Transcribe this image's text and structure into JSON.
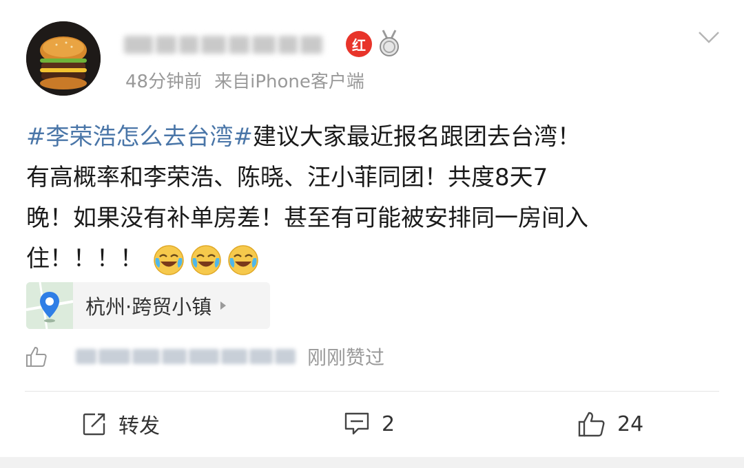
{
  "post": {
    "time": "48分钟前",
    "source": "来自iPhone客户端",
    "badge_label": "红",
    "hashtag": "#李荣浩怎么去台湾#",
    "text_line1": "建议大家最近报名跟团去台湾！",
    "text_line2": "有高概率和李荣浩、陈晓、汪小菲同团！共度8天7",
    "text_line3": "晚！如果没有补单房差！甚至有可能被安排同一房间入",
    "text_line4": "住！！！！",
    "emoji_names": [
      "laugh-cry-emoji",
      "laugh-cry-emoji",
      "laugh-cry-emoji"
    ]
  },
  "location": {
    "label": "杭州·跨贸小镇"
  },
  "liked": {
    "text": "刚刚赞过"
  },
  "actions": {
    "repost_label": "转发",
    "comment_count": "2",
    "like_count": "24"
  },
  "colors": {
    "hashtag": "#4a76a8",
    "meta": "#999999",
    "badge": "#e8342a"
  }
}
